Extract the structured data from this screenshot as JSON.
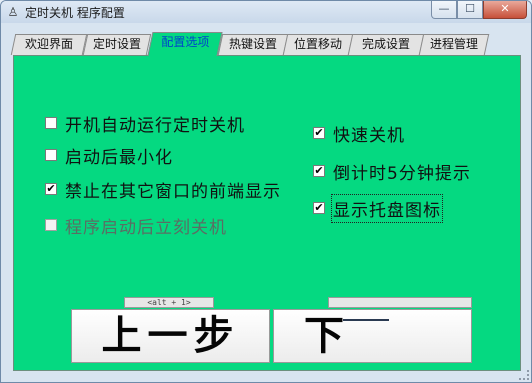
{
  "window": {
    "title": "定时关机 程序配置",
    "icon": "app-ghost-icon",
    "controls": {
      "minimize": "—",
      "maximize": "☐",
      "close": "✕"
    }
  },
  "tabs": [
    {
      "label": "欢迎界面",
      "active": false
    },
    {
      "label": "定时设置",
      "active": false
    },
    {
      "label": "配置选项",
      "active": true
    },
    {
      "label": "热键设置",
      "active": false
    },
    {
      "label": "位置移动",
      "active": false
    },
    {
      "label": "完成设置",
      "active": false
    },
    {
      "label": "进程管理",
      "active": false
    }
  ],
  "options_left": [
    {
      "label": "开机自动运行定时关机",
      "checked": false,
      "enabled": true
    },
    {
      "label": "启动后最小化",
      "checked": false,
      "enabled": true
    },
    {
      "label": "禁止在其它窗口的前端显示",
      "checked": true,
      "enabled": true
    },
    {
      "label": "程序启动后立刻关机",
      "checked": false,
      "enabled": false
    }
  ],
  "options_right": [
    {
      "label": "快速关机",
      "checked": true,
      "enabled": true
    },
    {
      "label": "倒计时5分钟提示",
      "checked": true,
      "enabled": true
    },
    {
      "label": "显示托盘图标",
      "checked": true,
      "enabled": true,
      "focused": true
    }
  ],
  "hints": {
    "prev": "<alt + 1>",
    "next": ""
  },
  "buttons": {
    "prev": "上一步",
    "next": "下"
  },
  "colors": {
    "panel": "#05d981",
    "active_tab_text": "#0044cc"
  }
}
